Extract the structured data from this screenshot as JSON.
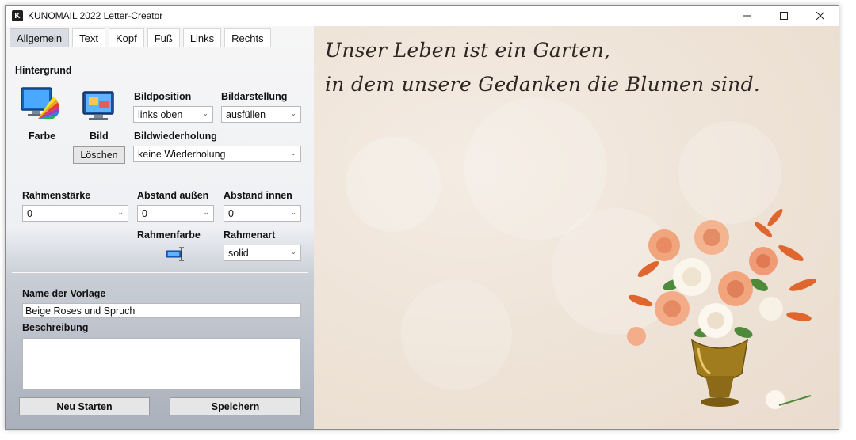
{
  "window": {
    "title": "KUNOMAIL 2022 Letter-Creator",
    "app_icon_letter": "K"
  },
  "tabs": [
    {
      "label": "Allgemein",
      "active": true
    },
    {
      "label": "Text",
      "active": false
    },
    {
      "label": "Kopf",
      "active": false
    },
    {
      "label": "Fuß",
      "active": false
    },
    {
      "label": "Links",
      "active": false
    },
    {
      "label": "Rechts",
      "active": false
    }
  ],
  "background": {
    "heading": "Hintergrund",
    "color_label": "Farbe",
    "image_label": "Bild",
    "delete_button": "Löschen",
    "position_label": "Bildposition",
    "position_value": "links oben",
    "display_label": "Bildarstellung",
    "display_value": "ausfüllen",
    "repeat_label": "Bildwiederholung",
    "repeat_value": "keine Wiederholung"
  },
  "frame": {
    "width_label": "Rahmenstärke",
    "width_value": "0",
    "outer_label": "Abstand außen",
    "outer_value": "0",
    "inner_label": "Abstand innen",
    "inner_value": "0",
    "color_label": "Rahmenfarbe",
    "style_label": "Rahmenart",
    "style_value": "solid"
  },
  "template": {
    "name_label": "Name der Vorlage",
    "name_value": "Beige Roses und Spruch",
    "description_label": "Beschreibung",
    "description_value": ""
  },
  "actions": {
    "restart_label": "Neu Starten",
    "save_label": "Speichern"
  },
  "preview": {
    "line1": "Unser Leben ist ein Garten,",
    "line2": "in dem unsere Gedanken die Blumen sind."
  },
  "colors": {
    "panel_top": "#f6f6f7",
    "panel_bottom": "#a9b0bb",
    "paper": "#efe4d8",
    "accent_blue": "#1f6fd1"
  },
  "icons": {
    "app": "app-icon",
    "minimize": "minimize-icon",
    "maximize": "maximize-icon",
    "close": "close-icon",
    "color": "color-palette-icon",
    "image": "monitor-image-icon",
    "frame_color": "color-picker-icon"
  }
}
